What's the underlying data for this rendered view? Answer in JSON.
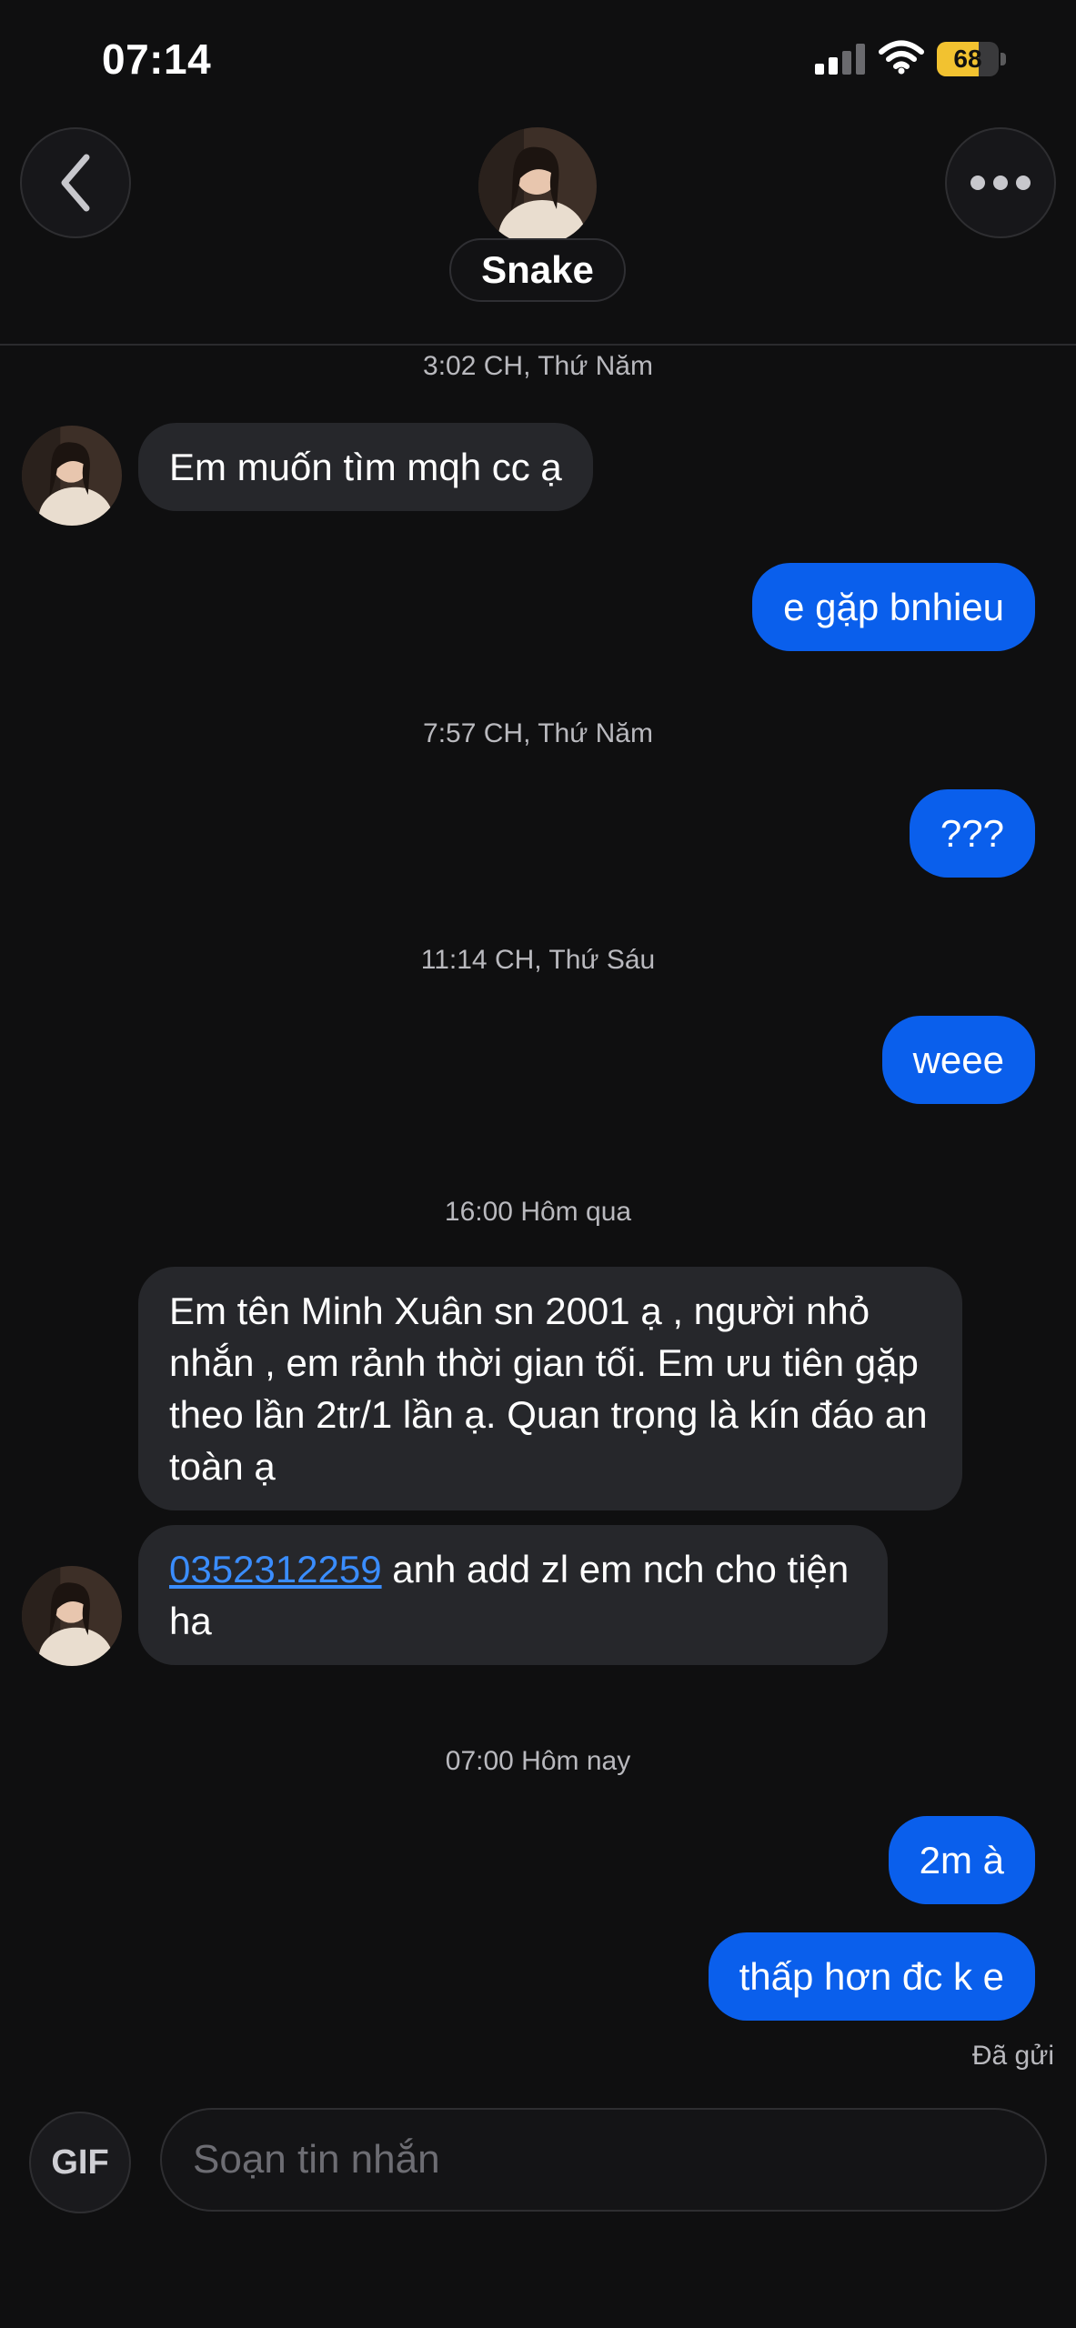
{
  "status": {
    "time": "07:14",
    "battery": "68",
    "battery_level": 0.68
  },
  "header": {
    "contact_name": "Snake"
  },
  "messages": [
    {
      "kind": "timestamp",
      "text": "3:02 CH, Thứ Năm"
    },
    {
      "kind": "incoming",
      "text": "Em muốn tìm mqh cc ạ"
    },
    {
      "kind": "outgoing",
      "text": "e gặp bnhieu"
    },
    {
      "kind": "timestamp",
      "text": "7:57 CH, Thứ Năm"
    },
    {
      "kind": "outgoing",
      "text": "???"
    },
    {
      "kind": "timestamp",
      "text": "11:14 CH, Thứ Sáu"
    },
    {
      "kind": "outgoing",
      "text": "weee"
    },
    {
      "kind": "timestamp",
      "text": "16:00 Hôm qua"
    },
    {
      "kind": "incoming",
      "text": "Em tên Minh Xuân sn 2001 ạ , người nhỏ nhắn , em rảnh thời gian tối. Em ưu tiên gặp theo lần 2tr/1 lần ạ. Quan trọng là kín đáo an toàn ạ"
    },
    {
      "kind": "incoming",
      "link": "0352312259",
      "text": " anh add zl em nch cho tiện ha"
    },
    {
      "kind": "timestamp",
      "text": "07:00 Hôm nay"
    },
    {
      "kind": "outgoing",
      "text": "2m à"
    },
    {
      "kind": "outgoing",
      "text": "thấp hơn đc k e"
    }
  ],
  "delivery_status": "Đã gửi",
  "composer": {
    "gif_label": "GIF",
    "placeholder": "Soạn tin nhắn"
  },
  "icons": {
    "back": "chevron-left-icon",
    "more": "more-horizontal-icon",
    "signal": "cellular-signal-icon",
    "wifi": "wifi-icon",
    "battery": "battery-icon"
  },
  "colors": {
    "background": "#0f0f10",
    "outgoing_bubble": "#0a5fec",
    "incoming_bubble": "#26272b",
    "link": "#3a8dff",
    "battery_fill": "#f2c230"
  }
}
